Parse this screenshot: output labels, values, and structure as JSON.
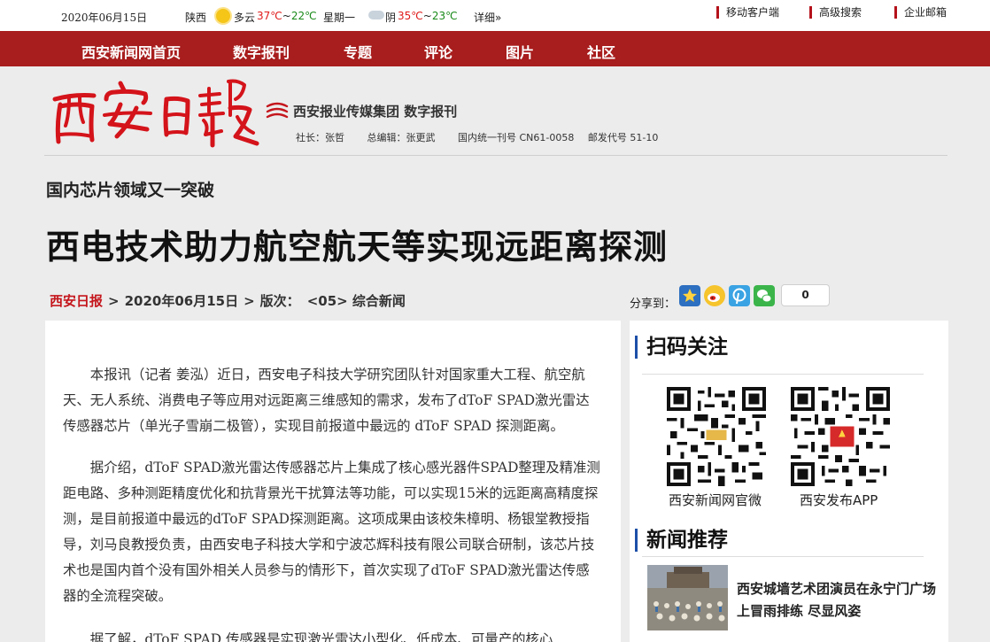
{
  "topbar": {
    "date": "2020年06月15日",
    "city": "陕西",
    "weather1": "多云",
    "temp1_high": "37℃",
    "temp1_sep": "~",
    "temp1_low": "22℃",
    "weekday": "星期一",
    "weather2": "阴",
    "temp2_high": "35℃",
    "temp2_sep": "~",
    "temp2_low": "23℃",
    "more": "详细»",
    "links": [
      "移动客户端",
      "高级搜索",
      "企业邮箱"
    ]
  },
  "nav": {
    "items": [
      "西安新闻网首页",
      "数字报刊",
      "专题",
      "评论",
      "图片",
      "社区"
    ]
  },
  "masthead": {
    "logo_text": "西安日报",
    "group_name": "西安报业传媒集团 数字报刊",
    "president": "社长：张哲",
    "chief_editor": "总编辑：张更武",
    "cn_number": "国内统一刊号 CN61-0058",
    "postal_code": "邮发代号 51-10"
  },
  "article": {
    "kicker": "国内芯片领域又一突破",
    "headline": "西电技术助力航空航天等实现远距离探测",
    "paper": "西安日报",
    "sep": ">",
    "date": "2020年06月15日",
    "edition_label": "版次：",
    "edition": "<05> 综合新闻",
    "paragraphs": [
      "本报讯（记者 姜泓）近日，西安电子科技大学研究团队针对国家重大工程、航空航天、无人系统、消费电子等应用对远距离三维感知的需求，发布了dToF SPAD激光雷达传感器芯片（单光子雪崩二极管），实现目前报道中最远的 dToF SPAD 探测距离。",
      "据介绍，dToF SPAD激光雷达传感器芯片上集成了核心感光器件SPAD整理及精准测距电路、多种测距精度优化和抗背景光干扰算法等功能，可以实现15米的远距离高精度探测，是目前报道中最远的dToF SPAD探测距离。这项成果由该校朱樟明、杨银堂教授指导，刘马良教授负责，由西安电子科技大学和宁波芯辉科技有限公司联合研制，该芯片技术也是国内首个没有国外相关人员参与的情形下，首次实现了dToF SPAD激光雷达传感器的全流程突破。",
      "据了解，dToF SPAD 传感器是实现激光雷达小型化、低成本、可量产的核心"
    ]
  },
  "share": {
    "label": "分享到：",
    "count": "0"
  },
  "sidebar": {
    "follow_title": "扫码关注",
    "qr1_caption": "西安新闻网官微",
    "qr2_caption": "西安发布APP",
    "news_title": "新闻推荐",
    "news_item": "西安城墙艺术团演员在永宁门广场上冒雨排练 尽显风姿"
  },
  "colors": {
    "nav_bg": "#a81d1d",
    "accent_red": "#c4161c",
    "side_accent": "#1d4fa8",
    "temp_hot": "#e01b1b",
    "temp_cool": "#1a8a1a"
  }
}
